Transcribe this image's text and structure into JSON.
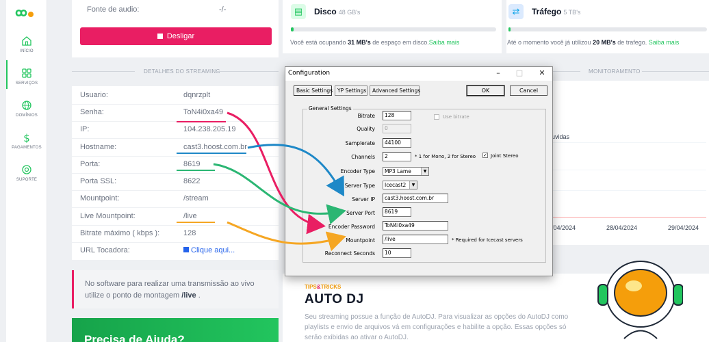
{
  "sidebar": {
    "items": [
      {
        "label": "INÍCIO",
        "icon": "home-icon"
      },
      {
        "label": "SERVIÇOS",
        "icon": "grid-icon"
      },
      {
        "label": "DOMÍNIOS",
        "icon": "globe-icon"
      },
      {
        "label": "PAGAMENTOS",
        "icon": "dollar-icon"
      },
      {
        "label": "SUPORTE",
        "icon": "lifebuoy-icon"
      }
    ],
    "accent": "#22c55e"
  },
  "audio": {
    "label": "Fonte de audio:",
    "value": "-/-"
  },
  "stop_button": {
    "label": "Desligar"
  },
  "details": {
    "title": "DETALHES DO STREAMING",
    "rows": [
      {
        "label": "Usuario:",
        "value": "dqnrzplt"
      },
      {
        "label": "Senha:",
        "value": "ToN4i0xa49"
      },
      {
        "label": "IP:",
        "value": "104.238.205.19"
      },
      {
        "label": "Hostname:",
        "value": "cast3.hoost.com.br"
      },
      {
        "label": "Porta:",
        "value": "8619"
      },
      {
        "label": "Porta SSL:",
        "value": "8622"
      },
      {
        "label": "Mountpoint:",
        "value": "/stream"
      },
      {
        "label": "Live Mountpoint:",
        "value": "/live"
      },
      {
        "label": "Bitrate máximo ( kbps ):",
        "value": "128"
      },
      {
        "label": "URL Tocadora:",
        "value": "Clique aqui..."
      }
    ]
  },
  "notice": {
    "text": "No software para realizar uma transmissão ao vivo utilize o ponto de montagem ",
    "bold": "/live",
    "end": " ."
  },
  "help": {
    "title": "Precisa de Ajuda?"
  },
  "disk": {
    "title": "Disco",
    "sub": "48 GB's",
    "progress": 0.01,
    "text_pre": "Você está ocupando ",
    "text_bold": "31 MB's",
    "text_post": " de espaço em disco.",
    "more": "Saiba mais"
  },
  "traffic": {
    "title": "Tráfego",
    "sub": "5 TB's",
    "progress": 0.005,
    "text_pre": "Até o momento você já utilizou ",
    "text_bold": "20 MB's",
    "text_post": " de trafego. ",
    "more": "Saiba mais"
  },
  "monitor": {
    "title": "MONITORAMENTO",
    "legend_fragment": "uvidas",
    "dates": [
      "/04/2024",
      "28/04/2024",
      "29/04/2024"
    ]
  },
  "autodj": {
    "tag_a": "TIPS",
    "tag_amp": "&",
    "tag_b": "TRICKS",
    "title": "AUTO DJ",
    "desc": "Seu streaming possue a função de AutoDJ. Para visualizar as opções do AutoDJ como playlists e envio de arquivos vá em configurações e habilite a opção. Essas opções só serão exibidas ao ativar o AutoDJ."
  },
  "dialog": {
    "title": "Configuration",
    "tabs": [
      "Basic Settings",
      "YP Settings",
      "Advanced Settings"
    ],
    "ok": "OK",
    "cancel": "Cancel",
    "group": "General Settings",
    "fields": {
      "bitrate": {
        "label": "Bitrate",
        "value": "128"
      },
      "quality": {
        "label": "Quality",
        "value": "0"
      },
      "samplerate": {
        "label": "Samplerate",
        "value": "44100"
      },
      "channels": {
        "label": "Channels",
        "value": "2",
        "note": "* 1 for Mono, 2 for Stereo"
      },
      "encoder_type": {
        "label": "Encoder Type",
        "value": "MP3 Lame"
      },
      "server_type": {
        "label": "Server Type",
        "value": "Icecast2"
      },
      "server_ip": {
        "label": "Server IP",
        "value": "cast3.hoost.com.br"
      },
      "server_port": {
        "label": "Server Port",
        "value": "8619"
      },
      "encoder_password": {
        "label": "Encoder Password",
        "value": "ToN4i0xa49"
      },
      "mountpoint": {
        "label": "Mountpoint",
        "value": "/live",
        "note": "* Required for Icecast servers"
      },
      "reconnect": {
        "label": "Reconnect Seconds",
        "value": "10"
      }
    },
    "use_bitrate": {
      "label": "Use bitrate",
      "checked": false
    },
    "joint_stereo": {
      "label": "Joint Stereo",
      "checked": true
    }
  },
  "arrow_colors": {
    "pink": "#e91e63",
    "blue": "#1e88c7",
    "green": "#2bb673",
    "orange": "#f5a623"
  }
}
